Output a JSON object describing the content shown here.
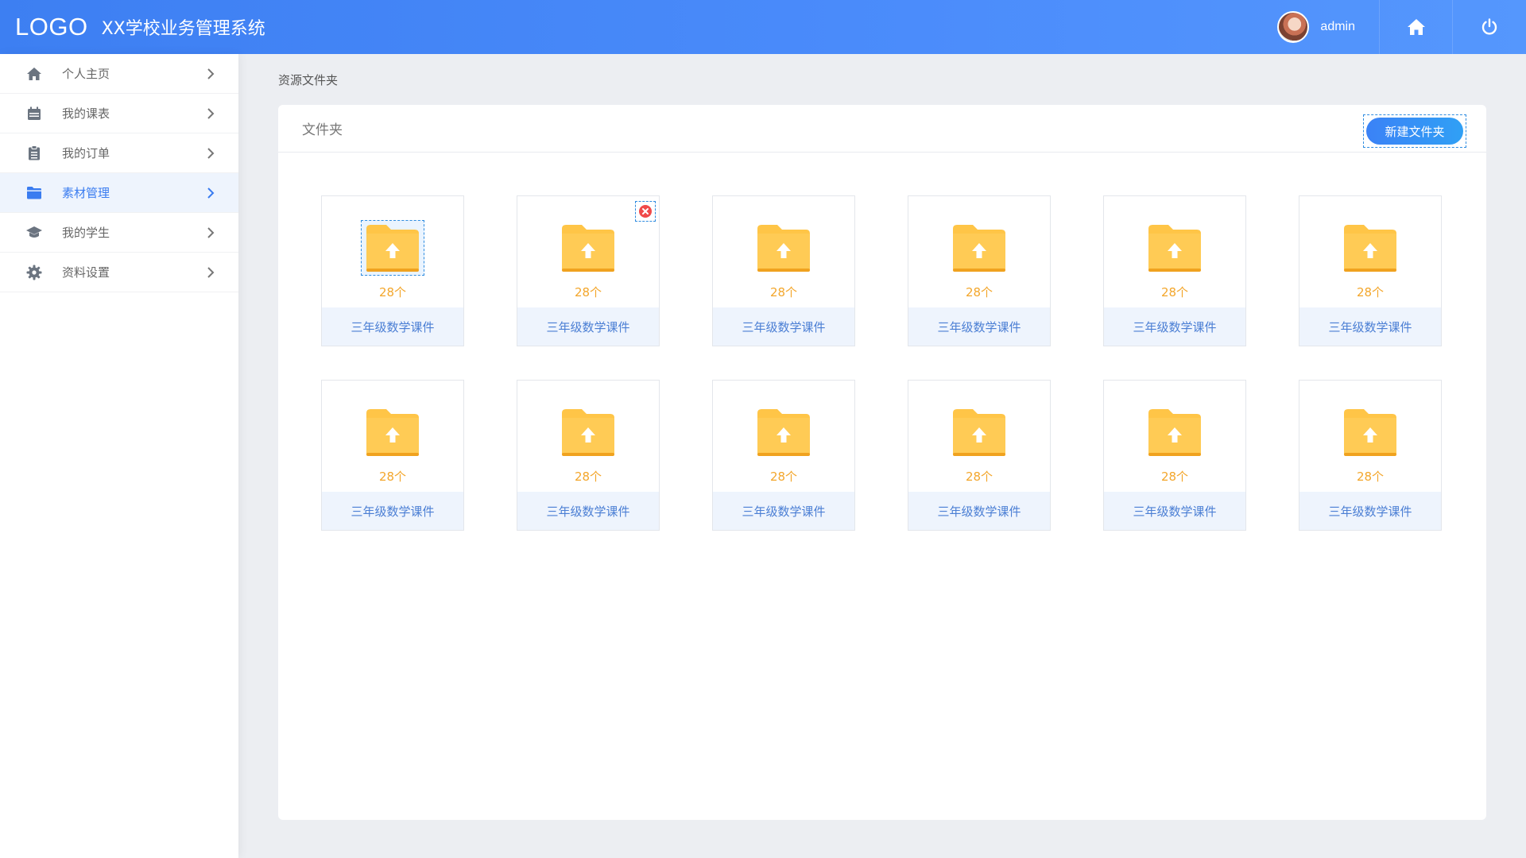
{
  "header": {
    "logo": "LOGO",
    "title": "XX学校业务管理系统",
    "username": "admin",
    "home_icon": "home-icon",
    "power_icon": "power-icon"
  },
  "sidebar": {
    "items": [
      {
        "label": "个人主页",
        "icon": "home-icon",
        "active": false
      },
      {
        "label": "我的课表",
        "icon": "calendar-icon",
        "active": false
      },
      {
        "label": "我的订单",
        "icon": "clipboard-icon",
        "active": false
      },
      {
        "label": "素材管理",
        "icon": "folder-icon",
        "active": true
      },
      {
        "label": "我的学生",
        "icon": "graduation-cap-icon",
        "active": false
      },
      {
        "label": "资料设置",
        "icon": "gear-icon",
        "active": false
      }
    ]
  },
  "breadcrumb": "资源文件夹",
  "panel": {
    "title": "文件夹",
    "new_folder_label": "新建文件夹"
  },
  "folders": [
    {
      "count": "28个",
      "name": "三年级数学课件"
    },
    {
      "count": "28个",
      "name": "三年级数学课件"
    },
    {
      "count": "28个",
      "name": "三年级数学课件"
    },
    {
      "count": "28个",
      "name": "三年级数学课件"
    },
    {
      "count": "28个",
      "name": "三年级数学课件"
    },
    {
      "count": "28个",
      "name": "三年级数学课件"
    },
    {
      "count": "28个",
      "name": "三年级数学课件"
    },
    {
      "count": "28个",
      "name": "三年级数学课件"
    },
    {
      "count": "28个",
      "name": "三年级数学课件"
    },
    {
      "count": "28个",
      "name": "三年级数学课件"
    },
    {
      "count": "28个",
      "name": "三年级数学课件"
    },
    {
      "count": "28个",
      "name": "三年级数学课件"
    }
  ],
  "colors": {
    "accent": "#3d7ff2",
    "folder": "#ffc547",
    "count": "#f3a62b",
    "delete": "#f04a4a"
  }
}
